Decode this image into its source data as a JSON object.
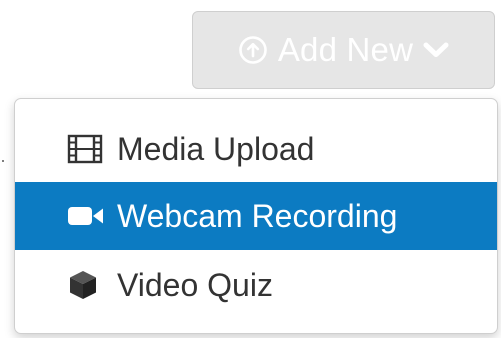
{
  "add_new_button": {
    "label": "Add New",
    "icon": "arrow-up-circle-icon",
    "caret_icon": "chevron-down-icon"
  },
  "menu": {
    "items": [
      {
        "label": "Media Upload",
        "icon": "film-icon",
        "active": false
      },
      {
        "label": "Webcam Recording",
        "icon": "video-camera-icon",
        "active": true
      },
      {
        "label": "Video Quiz",
        "icon": "cube-icon",
        "active": false
      }
    ]
  },
  "colors": {
    "button_bg": "#e6e6e6",
    "button_text": "#ffffff",
    "active_item_bg": "#0c7bc2",
    "item_text": "#333333"
  }
}
